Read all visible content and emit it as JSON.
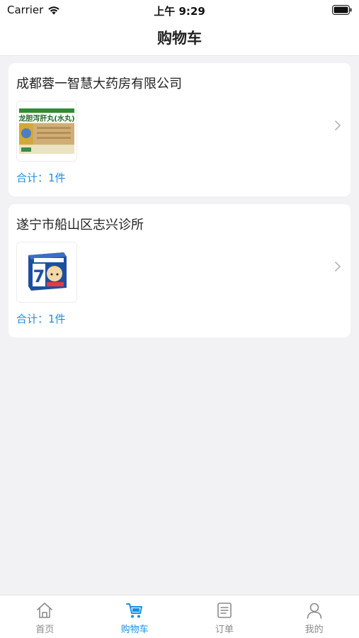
{
  "status_bar": {
    "carrier": "Carrier",
    "time": "上午 9:29"
  },
  "nav": {
    "title": "购物车"
  },
  "stores": [
    {
      "name": "成都蓉一智慧大药房有限公司",
      "product_image": "龙胆泻肝丸(水丸)",
      "total": "合计：1件"
    },
    {
      "name": "遂宁市船山区志兴诊所",
      "product_image": "7",
      "total": "合计：1件"
    }
  ],
  "tabs": [
    {
      "label": "首页",
      "icon": "home-icon"
    },
    {
      "label": "购物车",
      "icon": "cart-icon",
      "active": true
    },
    {
      "label": "订单",
      "icon": "order-list-icon"
    },
    {
      "label": "我的",
      "icon": "profile-icon"
    }
  ],
  "colors": {
    "accent": "#1a8fe0",
    "background": "#f2f2f4"
  }
}
